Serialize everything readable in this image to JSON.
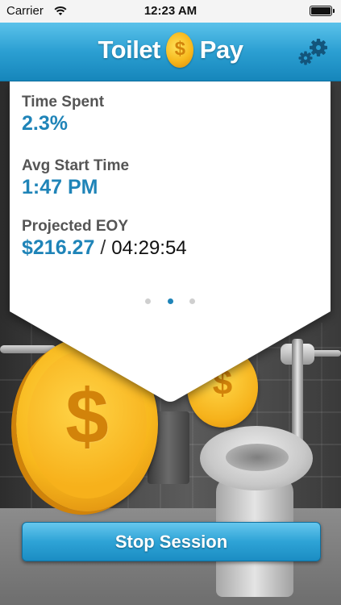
{
  "status_bar": {
    "carrier": "Carrier",
    "time": "12:23 AM"
  },
  "nav": {
    "logo_left": "Toilet",
    "logo_coin": "$",
    "logo_right": "Pay",
    "settings_icon": "gears-icon"
  },
  "stats": {
    "time_spent": {
      "label": "Time Spent",
      "value": "2.3%"
    },
    "avg_start": {
      "label": "Avg Start Time",
      "value": "1:47 PM"
    },
    "projected": {
      "label": "Projected EOY",
      "value": "$216.27",
      "separator": "/",
      "duration": "04:29:54"
    }
  },
  "pager": {
    "pages": 3,
    "active_index": 1
  },
  "background": {
    "coin_symbol": "$"
  },
  "actions": {
    "stop_label": "Stop Session"
  },
  "colors": {
    "accent": "#1f84b8",
    "nav_top": "#5bc2ea",
    "nav_bottom": "#1686bb",
    "coin": "#f8b81d"
  }
}
